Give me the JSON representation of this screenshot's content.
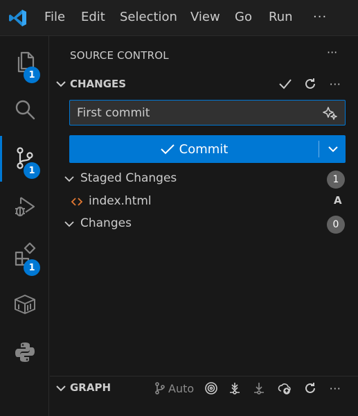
{
  "menu": {
    "items": [
      "File",
      "Edit",
      "Selection",
      "View",
      "Go",
      "Run"
    ],
    "more_label": "···"
  },
  "activity_bar": {
    "items": [
      {
        "icon": "files-icon",
        "badge": "1"
      },
      {
        "icon": "search-icon",
        "badge": ""
      },
      {
        "icon": "source-control-icon",
        "badge": "1",
        "active": true
      },
      {
        "icon": "run-debug-icon",
        "badge": ""
      },
      {
        "icon": "extensions-icon",
        "badge": "1"
      },
      {
        "icon": "remote-explorer-icon",
        "badge": ""
      },
      {
        "icon": "python-icon",
        "badge": ""
      }
    ]
  },
  "sidebar": {
    "title": "SOURCE CONTROL",
    "more_label": "···",
    "changes_section": {
      "title": "CHANGES",
      "more_label": "···"
    },
    "commit_message": {
      "value": "First commit"
    },
    "commit_button": {
      "label": "Commit"
    },
    "staged": {
      "label": "Staged Changes",
      "count": "1",
      "files": [
        {
          "name": "index.html",
          "status": "A"
        }
      ]
    },
    "changes": {
      "label": "Changes",
      "count": "0"
    },
    "graph_section": {
      "title": "GRAPH",
      "auto_label": "Auto",
      "more_label": "···"
    }
  },
  "colors": {
    "accent": "#0078d4",
    "background": "#181818",
    "html_icon": "#e37933"
  }
}
